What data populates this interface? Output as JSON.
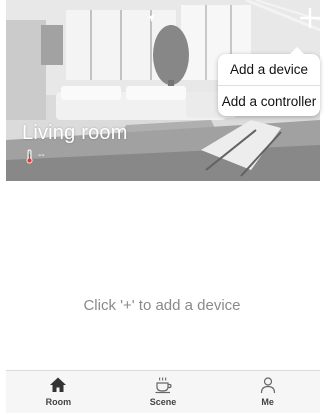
{
  "room": {
    "title": "Living room",
    "temperature_value": "--",
    "temperature_icon": "thermometer-icon"
  },
  "header": {
    "add_icon": "plus-icon"
  },
  "menu": {
    "items": [
      {
        "label": "Add a device"
      },
      {
        "label": "Add a controller"
      }
    ]
  },
  "empty_state": {
    "text": "Click '+' to add a device"
  },
  "tabbar": {
    "tabs": [
      {
        "label": "Room",
        "icon": "home-icon"
      },
      {
        "label": "Scene",
        "icon": "coffee-cup-icon"
      },
      {
        "label": "Me",
        "icon": "person-icon"
      }
    ]
  },
  "colors": {
    "menu_background": "#ffffff",
    "hint_text": "#8a8a8a",
    "tabbar_background": "#f6f6f6"
  }
}
